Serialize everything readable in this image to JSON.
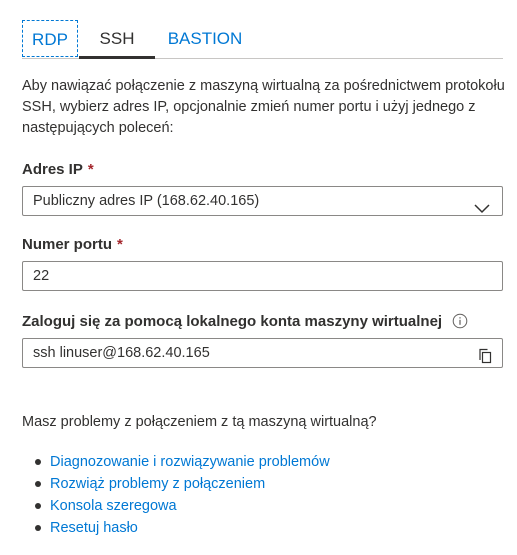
{
  "tabs": [
    {
      "label": "RDP"
    },
    {
      "label": "SSH"
    },
    {
      "label": "BASTION"
    }
  ],
  "description": "Aby nawiązać połączenie z maszyną wirtualną za pośrednictwem protokołu SSH, wybierz adres IP, opcjonalnie zmień numer portu i użyj jednego z następujących poleceń:",
  "ip": {
    "label": "Adres IP",
    "required_mark": "*",
    "selected_value": "Publiczny adres IP (168.62.40.165)"
  },
  "port": {
    "label": "Numer portu",
    "required_mark": "*",
    "value": "22"
  },
  "login": {
    "label": "Zaloguj się za pomocą lokalnego konta maszyny wirtualnej",
    "command": "ssh linuser@168.62.40.165"
  },
  "troubleshoot": {
    "question": "Masz problemy z połączeniem z tą maszyną wirtualną?",
    "links": [
      {
        "label": "Diagnozowanie i rozwiązywanie problemów"
      },
      {
        "label": "Rozwiąż problemy z połączeniem"
      },
      {
        "label": "Konsola szeregowa"
      },
      {
        "label": "Resetuj hasło"
      }
    ]
  },
  "colors": {
    "accent": "#0078d4",
    "required": "#a4262c",
    "text": "#323130",
    "border": "#8a8886"
  }
}
